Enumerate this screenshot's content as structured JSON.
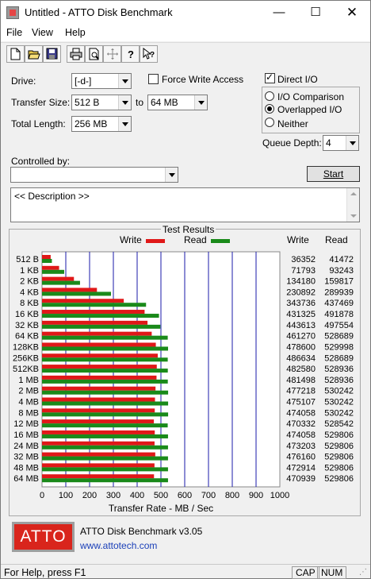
{
  "window": {
    "title": "Untitled - ATTO Disk Benchmark"
  },
  "menu": {
    "file": "File",
    "view": "View",
    "help": "Help"
  },
  "toolbar": {
    "icons": [
      "new-icon",
      "open-icon",
      "save-icon",
      "print-icon",
      "print-preview-icon",
      "move-icon",
      "help-icon",
      "context-help-icon"
    ]
  },
  "settings": {
    "drive_label": "Drive:",
    "drive_value": "[-d-]",
    "transfer_size_label": "Transfer Size:",
    "transfer_from": "512 B",
    "to_label": "to",
    "transfer_to": "64 MB",
    "total_length_label": "Total Length:",
    "total_length": "256 MB",
    "force_write_access": "Force Write Access",
    "force_write_checked": false,
    "direct_io": "Direct I/O",
    "direct_io_checked": true,
    "io_comparison": "I/O Comparison",
    "overlapped_io": "Overlapped I/O",
    "neither": "Neither",
    "selected_mode": "Overlapped I/O",
    "queue_depth_label": "Queue Depth:",
    "queue_depth": "4",
    "controlled_by_label": "Controlled by:",
    "controlled_by": "",
    "start_button": "Start",
    "description": "<< Description >>"
  },
  "results": {
    "group_title": "Test Results",
    "legend_write": "Write",
    "legend_read": "Read",
    "col_write": "Write",
    "col_read": "Read",
    "x_axis_label": "Transfer Rate - MB / Sec",
    "write_color": "#e01818",
    "read_color": "#1a8a1a",
    "grid_color": "#1a1aaa"
  },
  "chart_data": {
    "type": "bar",
    "orientation": "horizontal",
    "xlabel": "Transfer Rate - MB / Sec",
    "xlim": [
      0,
      1000
    ],
    "x_ticks": [
      "0",
      "100",
      "200",
      "300",
      "400",
      "500",
      "600",
      "700",
      "800",
      "900",
      "1000"
    ],
    "categories": [
      "512 B",
      "1 KB",
      "2 KB",
      "4 KB",
      "8 KB",
      "16 KB",
      "32 KB",
      "64 KB",
      "128KB",
      "256KB",
      "512KB",
      "1 MB",
      "2 MB",
      "4 MB",
      "8 MB",
      "12 MB",
      "16 MB",
      "24 MB",
      "32 MB",
      "48 MB",
      "64 MB"
    ],
    "series": [
      {
        "name": "Write",
        "values": [
          36352,
          71793,
          134180,
          230892,
          343736,
          431325,
          443613,
          461270,
          478600,
          486634,
          482580,
          481498,
          477218,
          475107,
          474058,
          470332,
          474058,
          473203,
          476160,
          472914,
          470939
        ]
      },
      {
        "name": "Read",
        "values": [
          41472,
          93243,
          159817,
          289939,
          437469,
          491878,
          497554,
          528689,
          529998,
          528689,
          528936,
          528936,
          530242,
          530242,
          530242,
          528542,
          529806,
          529806,
          529806,
          529806,
          529806
        ]
      }
    ],
    "value_unit_divisor": 1000
  },
  "footer": {
    "logo_text": "ATTO",
    "product": "ATTO Disk Benchmark v3.05",
    "url": "www.attotech.com"
  },
  "statusbar": {
    "text": "For Help, press F1",
    "cap": "CAP",
    "num": "NUM"
  }
}
